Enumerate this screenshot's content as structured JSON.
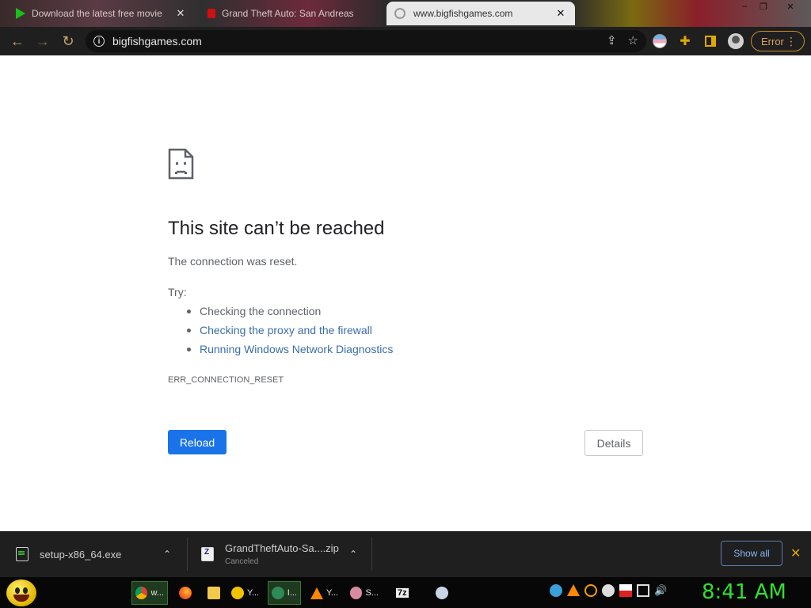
{
  "browser": {
    "tabs": [
      {
        "title": "Download the latest free movie...",
        "favicon": "play-icon",
        "active": false
      },
      {
        "title": "Grand Theft Auto: San Andreas",
        "favicon": "lock-icon",
        "active": false
      },
      {
        "title": "www.bigfishgames.com",
        "favicon": "globe-icon",
        "active": true
      }
    ],
    "window_controls": {
      "minimize": "–",
      "restore": "❐",
      "close": "✕"
    },
    "toolbar": {
      "back": "←",
      "forward": "→",
      "reload": "↻",
      "url": "bigfishgames.com",
      "info_glyph": "i",
      "share_glyph": "⇪",
      "bookmark_glyph": "☆",
      "extensions_glyph": "✚",
      "error_label": "Error",
      "menu_glyph": "⋮"
    }
  },
  "page": {
    "headline": "This site can’t be reached",
    "subtext": "The connection was reset.",
    "try_label": "Try:",
    "suggestions": [
      {
        "text": "Checking the connection",
        "link": false
      },
      {
        "text": "Checking the proxy and the firewall",
        "link": true
      },
      {
        "text": "Running Windows Network Diagnostics",
        "link": true
      }
    ],
    "error_code": "ERR_CONNECTION_RESET",
    "reload_label": "Reload",
    "details_label": "Details"
  },
  "downloads": {
    "items": [
      {
        "name": "setup-x86_64.exe",
        "status": ""
      },
      {
        "name": "GrandTheftAuto-Sa....zip",
        "status": "Canceled"
      }
    ],
    "show_all_label": "Show all",
    "close_glyph": "✕",
    "chevron_glyph": "⌃"
  },
  "taskbar": {
    "apps": [
      {
        "label": "w...",
        "icon": "chrome-icon",
        "active": true
      },
      {
        "label": "",
        "icon": "firefox-icon",
        "active": false
      },
      {
        "label": "",
        "icon": "folder-icon",
        "active": false
      },
      {
        "label": "Y...",
        "icon": "smiley-icon",
        "active": false
      },
      {
        "label": "I...",
        "icon": "network-icon",
        "active": true
      },
      {
        "label": "Y...",
        "icon": "vlc-icon",
        "active": false
      },
      {
        "label": "S...",
        "icon": "brain-icon",
        "active": false
      },
      {
        "label": "7z",
        "icon": "7zip-icon",
        "active": false
      },
      {
        "label": "",
        "icon": "gauge-icon",
        "active": false
      }
    ],
    "clock": "8:41 AM"
  },
  "colors": {
    "accent_blue": "#1a73e8",
    "link_blue": "#3b6ea8",
    "error_orange": "#e0a060",
    "clock_green": "#2fe02f"
  }
}
